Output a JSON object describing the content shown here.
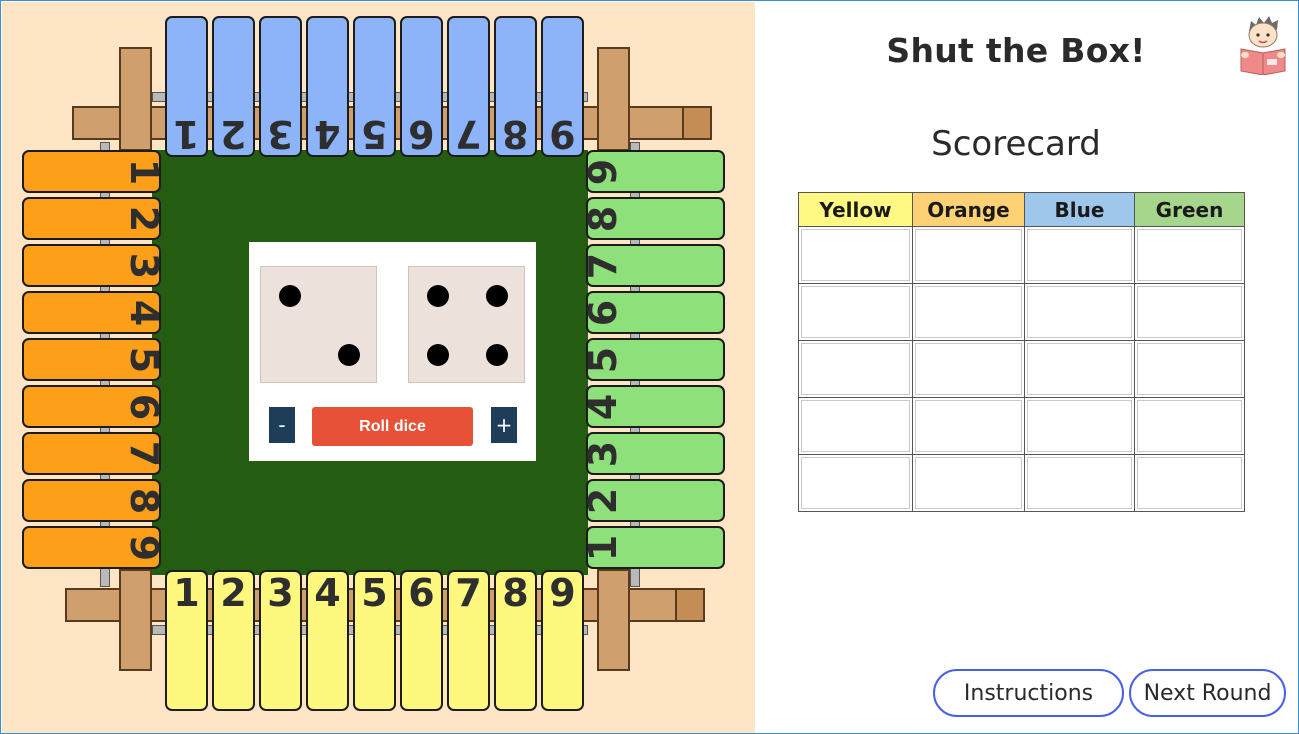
{
  "app": {
    "title": "Shut the Box!",
    "scorecard_title": "Scorecard",
    "icon": "reading-boy-icon"
  },
  "board": {
    "colors": {
      "felt": "#245c12",
      "background": "#fde5c6",
      "blue": "#8db3f9",
      "yellow": "#fff87f",
      "orange": "#fe9f1a",
      "green": "#8ee07a",
      "wood": "#cf9f6d"
    },
    "top_tiles": [
      "1",
      "2",
      "3",
      "4",
      "5",
      "6",
      "7",
      "8",
      "9"
    ],
    "bottom_tiles": [
      "1",
      "2",
      "3",
      "4",
      "5",
      "6",
      "7",
      "8",
      "9"
    ],
    "left_tiles": [
      "1",
      "2",
      "3",
      "4",
      "5",
      "6",
      "7",
      "8",
      "9"
    ],
    "right_tiles": [
      "9",
      "8",
      "7",
      "6",
      "5",
      "4",
      "3",
      "2",
      "1"
    ]
  },
  "dice": {
    "die1_value": 2,
    "die2_value": 4,
    "decrease_label": "-",
    "increase_label": "+",
    "roll_label": "Roll dice",
    "roll_color": "#e65138"
  },
  "scorecard": {
    "columns": [
      {
        "label": "Yellow",
        "color": "#fff983"
      },
      {
        "label": "Orange",
        "color": "#fdd174"
      },
      {
        "label": "Blue",
        "color": "#9fc6eb"
      },
      {
        "label": "Green",
        "color": "#a6d58c"
      }
    ],
    "rows": [
      [
        "",
        "",
        "",
        ""
      ],
      [
        "",
        "",
        "",
        ""
      ],
      [
        "",
        "",
        "",
        ""
      ],
      [
        "",
        "",
        "",
        ""
      ],
      [
        "",
        "",
        "",
        ""
      ]
    ]
  },
  "buttons": {
    "instructions": "Instructions",
    "next_round": "Next Round"
  }
}
